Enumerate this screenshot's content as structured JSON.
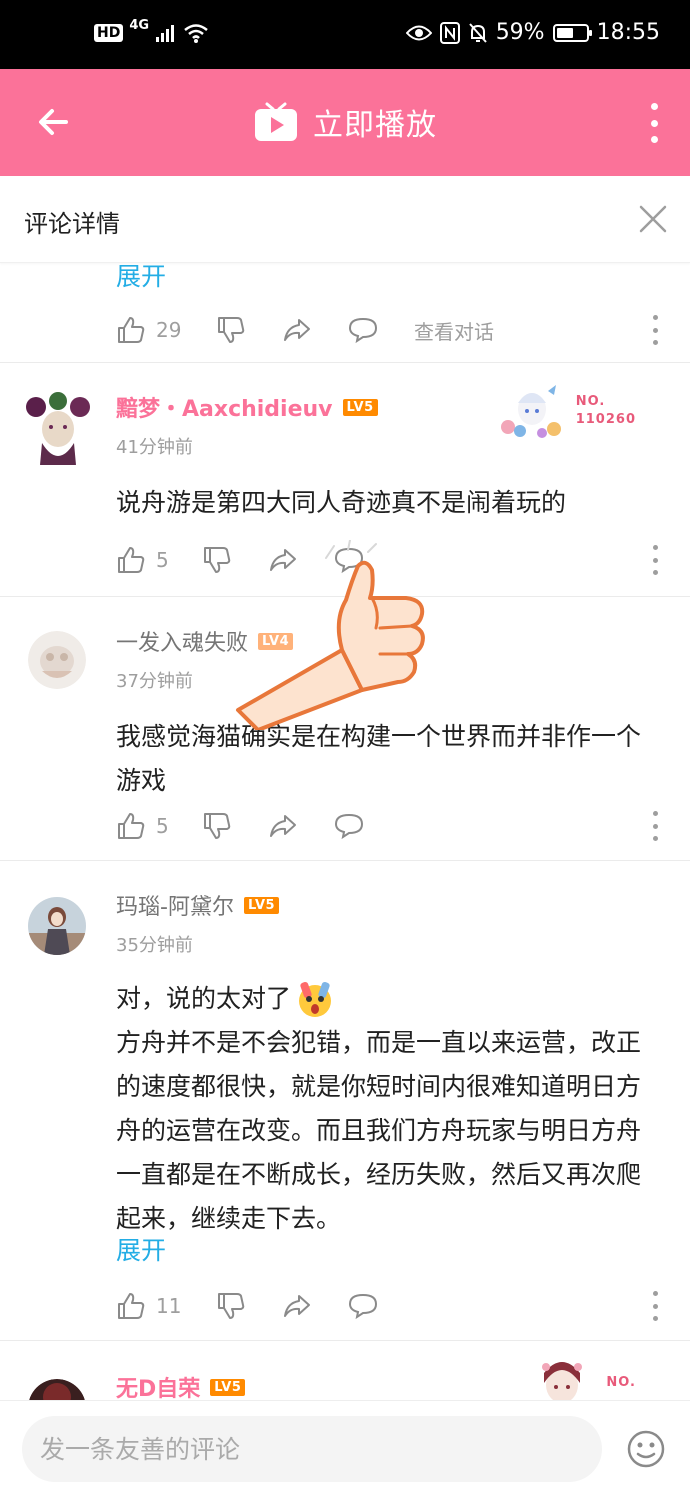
{
  "status": {
    "network": "4G",
    "hd": "HD",
    "battery": "59%",
    "battery_level": 0.59,
    "time": "18:55"
  },
  "appbar": {
    "title": "立即播放"
  },
  "detail": {
    "title": "评论详情"
  },
  "comments": [
    {
      "expand": "展开",
      "likes": "29",
      "dialog": "查看对话"
    },
    {
      "name": "黯梦・Aaxchidieuv",
      "level": "LV5",
      "time": "41分钟前",
      "text": "说舟游是第四大同人奇迹真不是闹着玩的",
      "likes": "5",
      "fan_no_label": "NO.",
      "fan_no": "110260"
    },
    {
      "name": "一发入魂失败",
      "level": "LV4",
      "time": "37分钟前",
      "text": "我感觉海猫确实是在构建一个世界而并非作一个游戏",
      "likes": "5"
    },
    {
      "name": "玛瑙-阿黛尔",
      "level": "LV5",
      "time": "35分钟前",
      "text_line1": "对，说的太对了",
      "text_body": "方舟并不是不会犯错，而是一直以来运营，改正的速度都很快，就是你短时间内很难知道明日方舟的运营在改变。而且我们方舟玩家与明日方舟一直都是在不断成长，经历失败，然后又再次爬起来，继续走下去。",
      "expand": "展开",
      "likes": "11"
    },
    {
      "name": "无D自荣",
      "level": "LV5",
      "fan_no_label": "NO."
    }
  ],
  "input": {
    "placeholder": "发一条友善的评论"
  }
}
